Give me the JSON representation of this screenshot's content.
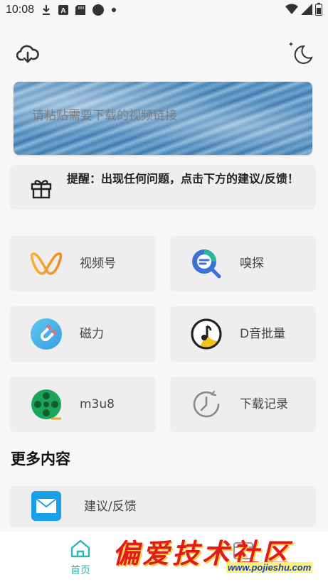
{
  "status_bar": {
    "time": "10:08",
    "icons_left": [
      "download-icon",
      "a-badge-icon",
      "sd-card-icon",
      "circle-icon",
      "dot-icon"
    ],
    "icons_right": [
      "wifi-icon",
      "signal-icon",
      "battery-icon"
    ]
  },
  "header": {
    "left_icon": "cloud-download-icon",
    "right_icon": "night-mode-icon"
  },
  "banner": {
    "placeholder": "请粘贴需要下载的视频链接"
  },
  "notice": {
    "icon": "gift-icon",
    "text": "提醒：出现任何问题，点击下方的建议/反馈！"
  },
  "tiles": [
    {
      "label": "视频号",
      "icon": "channels-icon"
    },
    {
      "label": "嗅探",
      "icon": "sniff-search-icon"
    },
    {
      "label": "磁力",
      "icon": "magnet-icon"
    },
    {
      "label": "D音批量",
      "icon": "music-note-icon"
    },
    {
      "label": "m3u8",
      "icon": "film-reel-icon"
    },
    {
      "label": "下载记录",
      "icon": "history-clock-icon"
    }
  ],
  "more_section": {
    "title": "更多内容",
    "items": [
      {
        "label": "建议/反馈",
        "icon": "mail-icon"
      }
    ]
  },
  "bottom_nav": {
    "home_label": "首页",
    "home_icon": "home-icon",
    "other_icon": "browser-window-icon"
  },
  "watermark": {
    "text": "偏爱技术社区",
    "url": "www.pojieshu.com"
  },
  "colors": {
    "accent": "#2fb5b0",
    "tile_bg": "#eeeeee",
    "page_bg": "#f7f7f7"
  }
}
